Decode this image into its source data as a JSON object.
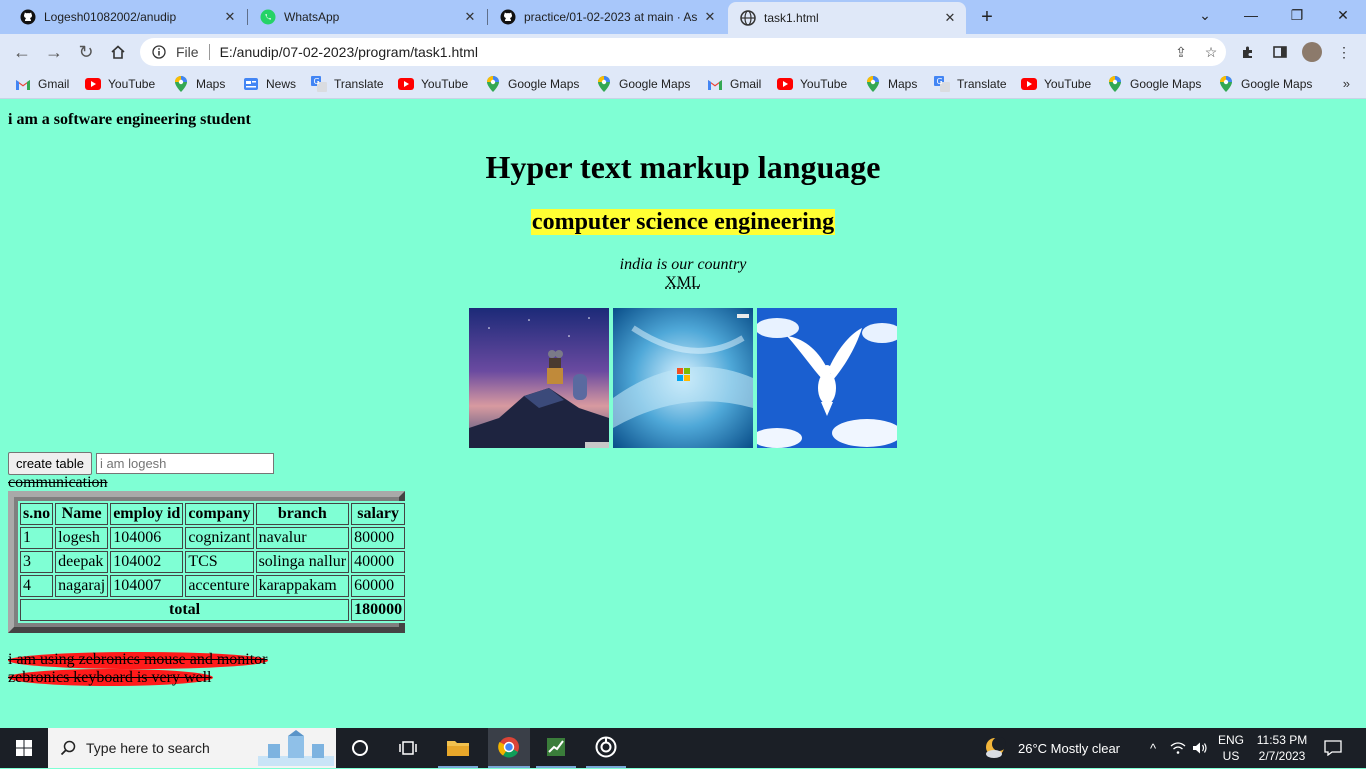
{
  "tabs": [
    {
      "title": "Logesh01082002/anudip",
      "icon": "github-icon"
    },
    {
      "title": "WhatsApp",
      "icon": "whatsapp-icon"
    },
    {
      "title": "practice/01-02-2023 at main · As",
      "icon": "github-icon"
    },
    {
      "title": "task1.html",
      "icon": "globe-icon",
      "active": true
    }
  ],
  "address": {
    "scheme_label": "File",
    "url": "E:/anudip/07-02-2023/program/task1.html"
  },
  "bookmarks": [
    {
      "label": "Gmail",
      "icon": "gmail-icon"
    },
    {
      "label": "YouTube",
      "icon": "youtube-icon"
    },
    {
      "label": "Maps",
      "icon": "maps-icon"
    },
    {
      "label": "News",
      "icon": "news-icon"
    },
    {
      "label": "Translate",
      "icon": "translate-icon"
    },
    {
      "label": "YouTube",
      "icon": "youtube-icon"
    },
    {
      "label": "Google Maps",
      "icon": "maps-icon"
    },
    {
      "label": "Google Maps",
      "icon": "maps-icon"
    },
    {
      "label": "Gmail",
      "icon": "gmail-icon"
    },
    {
      "label": "YouTube",
      "icon": "youtube-icon"
    },
    {
      "label": "Maps",
      "icon": "maps-icon"
    },
    {
      "label": "Translate",
      "icon": "translate-icon"
    },
    {
      "label": "YouTube",
      "icon": "youtube-icon"
    },
    {
      "label": "Google Maps",
      "icon": "maps-icon"
    },
    {
      "label": "Google Maps",
      "icon": "maps-icon"
    }
  ],
  "page": {
    "intro": "i am a software engineering student",
    "heading": "Hyper text markup language",
    "subheading": "computer science engineering",
    "italic_line": "india is our country",
    "abbr": "XML",
    "images": [
      "wall-e-robot-image",
      "windows-xp-wallpaper-image",
      "white-dove-image"
    ],
    "button_label": "create table",
    "input_placeholder": "i am logesh",
    "struck_text": "communication",
    "table": {
      "headers": [
        "s.no",
        "Name",
        "employ id",
        "company",
        "branch",
        "salary"
      ],
      "rows": [
        [
          "1",
          "logesh",
          "104006",
          "cognizant",
          "navalur",
          "80000"
        ],
        [
          "3",
          "deepak",
          "104002",
          "TCS",
          "solinga nallur",
          "40000"
        ],
        [
          "4",
          "nagaraj",
          "104007",
          "accenture",
          "karappakam",
          "60000"
        ]
      ],
      "total_label": "total",
      "total_value": "180000"
    },
    "marquee1": "i am using zebronics mouse and monitor",
    "marquee2": "zebronics keyboard is very well",
    "colors": {
      "background": "#7fffd4",
      "highlight": "#ffff33",
      "pill": "#ff1a1a"
    }
  },
  "taskbar": {
    "search_placeholder": "Type here to search",
    "weather": "26°C  Mostly clear",
    "lang1": "ENG",
    "lang2": "US",
    "time": "11:53 PM",
    "date": "2/7/2023"
  }
}
